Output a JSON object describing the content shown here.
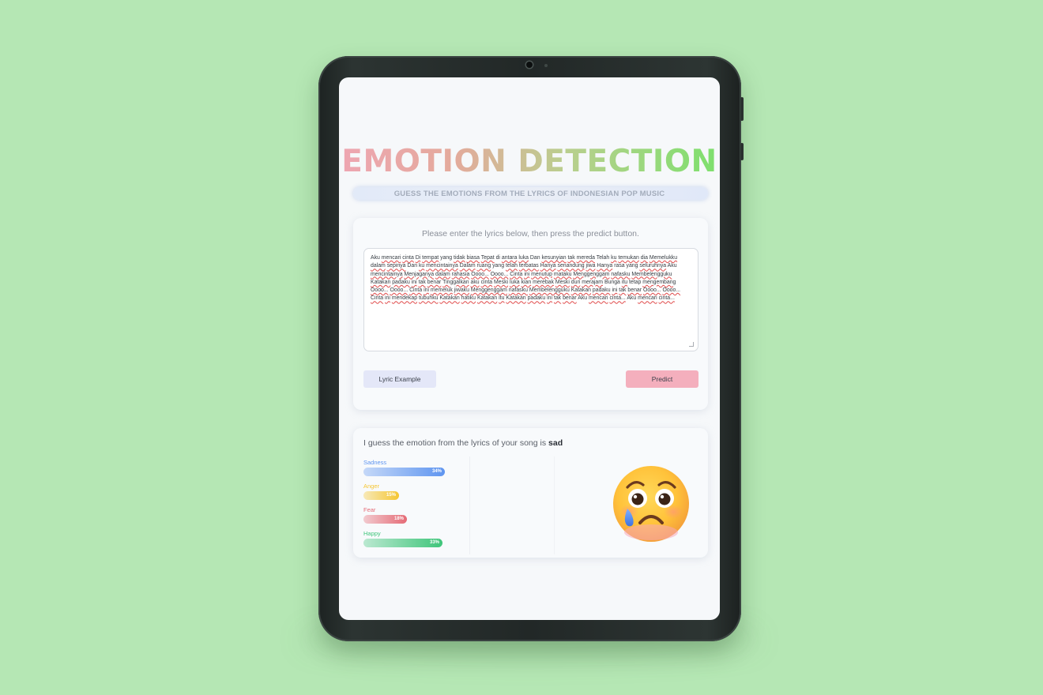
{
  "app": {
    "title": "EMOTION DETECTION",
    "subtitle": "GUESS THE EMOTIONS FROM THE LYRICS OF INDONESIAN POP MUSIC"
  },
  "input_card": {
    "instruction": "Please enter the lyrics below, then press the predict button.",
    "lyrics": "Aku mencari cinta Di tempat yang tidak biasa Tepat di antara luka Dan kesunyian tak mereda Telah ku temukan dia Memelukku dalam sepinya Dan ku mencintainya Dalam ruang yang telah terbatas Hanya senandung jiwa Hanya rasa yang seluruhnya Aku mencintainya Menjaganya dalam rahasia Oooo... Oooo... Cinta ini menutup mataku Menggenggam nafasku Membelengguku Katakan padaku ini tak benar Tinggalkan aku cinta Meski luka kian merebak Meski duri merajam Bunga itu tetap mengembang Oooo... Oooo... Cinta ini memeluk jiwaku Menggenggam nafasku Membelengguku Katakan padaku ini tak benar Oooo... Oooo... Cinta ini mendekap tubuhku Katakan hatiku Katakan itu Katakan padaku ini tak benar Aku mencari cinta... Aku mencari cinta...",
    "example_button": "Lyric Example",
    "predict_button": "Predict"
  },
  "result_card": {
    "result_prefix": "I guess the emotion from the lyrics of your song is",
    "result_value": "sad",
    "emotions": [
      {
        "label": "Sadness",
        "value": 34,
        "percent_text": "34%",
        "color": "#5f95f0"
      },
      {
        "label": "Anger",
        "value": 15,
        "percent_text": "15%",
        "color": "#f5c632"
      },
      {
        "label": "Fear",
        "value": 18,
        "percent_text": "18%",
        "color": "#e56b76"
      },
      {
        "label": "Happy",
        "value": 33,
        "percent_text": "33%",
        "color": "#3fc57a"
      }
    ],
    "emoji": "sad-tear-face-icon"
  },
  "colors": {
    "background": "#b5e7b4",
    "title_gradient_start": "#eea6b2",
    "title_gradient_end": "#7de06d",
    "predict_button": "#f4afbd",
    "example_button": "#e4e7f8"
  }
}
